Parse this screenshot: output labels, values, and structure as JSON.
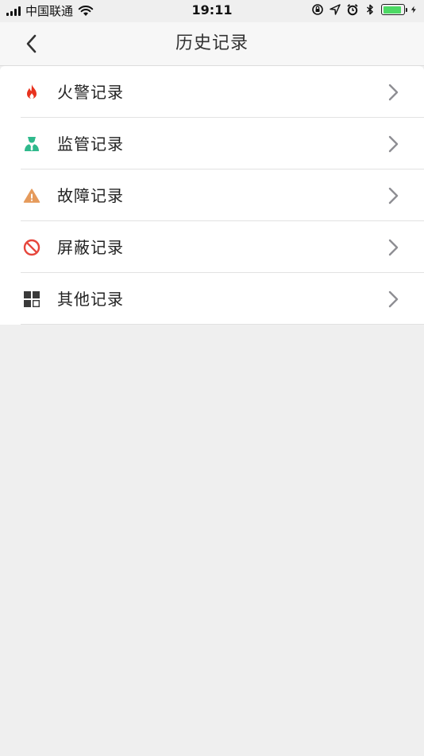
{
  "status_bar": {
    "carrier": "中国联通",
    "time": "19:11",
    "battery_level": 0.9,
    "battery_color": "#4cd964"
  },
  "nav": {
    "title": "历史记录",
    "back_icon": "chevron-left-icon"
  },
  "list": {
    "items": [
      {
        "label": "火警记录",
        "icon": "fire-icon",
        "icon_color": "#e8321e"
      },
      {
        "label": "监管记录",
        "icon": "supervisor-icon",
        "icon_color": "#2fb98c"
      },
      {
        "label": "故障记录",
        "icon": "warning-icon",
        "icon_color": "#e59a5b"
      },
      {
        "label": "屏蔽记录",
        "icon": "prohibited-icon",
        "icon_color": "#e6463c"
      },
      {
        "label": "其他记录",
        "icon": "grid-icon",
        "icon_color": "#3a3a3a"
      }
    ]
  },
  "colors": {
    "background": "#efefef",
    "nav_background": "#f7f7f7",
    "chevron": "#8e8e93"
  }
}
